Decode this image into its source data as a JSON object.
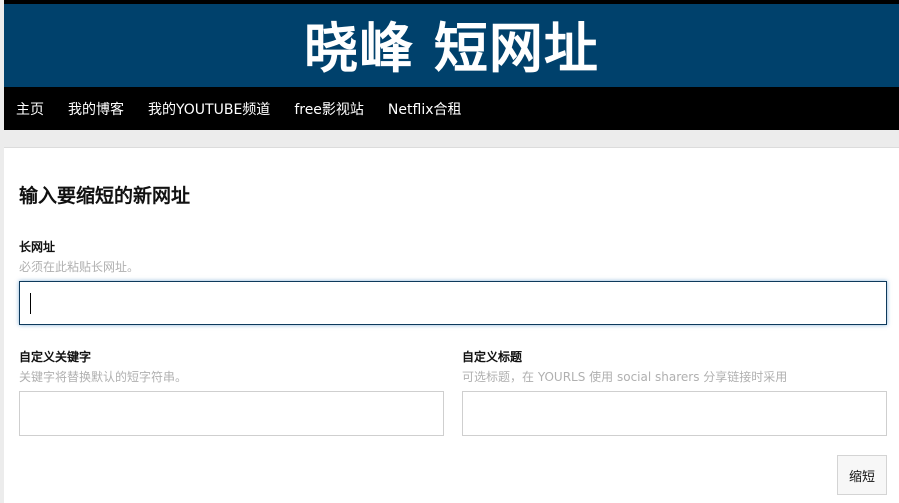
{
  "header": {
    "site_title": "晓峰 短网址"
  },
  "nav": {
    "items": [
      {
        "label": "主页"
      },
      {
        "label": "我的博客"
      },
      {
        "label": "我的YOUTUBE频道"
      },
      {
        "label": "free影视站"
      },
      {
        "label": "Netflix合租"
      }
    ]
  },
  "form": {
    "heading": "输入要缩短的新网址",
    "long_url": {
      "label": "长网址",
      "help": "必须在此粘贴长网址。",
      "value": ""
    },
    "keyword": {
      "label": "自定义关键字",
      "help": "关键字将替换默认的短字符串。",
      "value": ""
    },
    "title": {
      "label": "自定义标题",
      "help": "可选标题，在 YOURLS 使用 social sharers 分享链接时采用",
      "value": ""
    },
    "submit_label": "缩短"
  },
  "colors": {
    "banner_bg": "#00416c",
    "nav_bg": "#000000",
    "focus_border": "#0e3a5c"
  }
}
